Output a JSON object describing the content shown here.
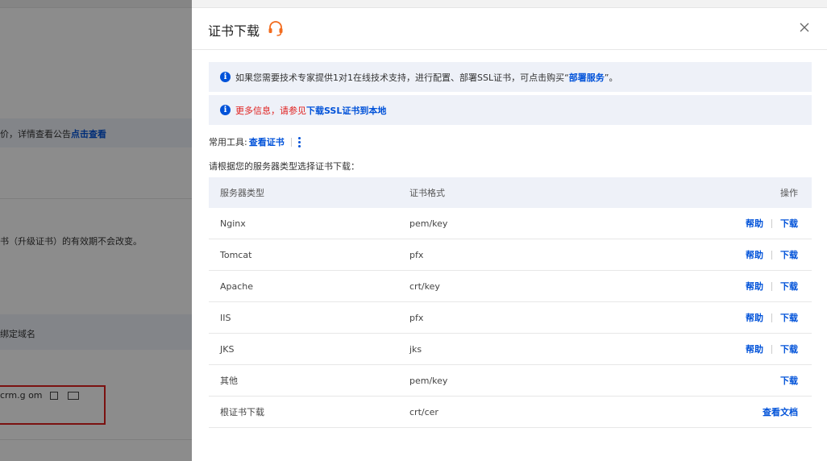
{
  "background": {
    "lines": [
      {
        "prefix": "价，详情查看公告",
        "link": "点击查看"
      },
      {
        "prefix": "书（升级证书）的有效期不会改变。",
        "link": ""
      },
      {
        "prefix": "绑定域名",
        "link": ""
      },
      {
        "prefix": "crm.g        om",
        "link": ""
      }
    ]
  },
  "drawer": {
    "title": "证书下载",
    "notices": [
      {
        "text": "如果您需要技术专家提供1对1在线技术支持，进行配置、部署SSL证书，可点击购买“",
        "link": "部署服务",
        "suffix": "”。"
      },
      {
        "text": "更多信息，请参见",
        "link": "下载SSL证书到本地",
        "suffix": ""
      }
    ],
    "tools": {
      "label": "常用工具:",
      "link": "查看证书"
    },
    "hint": "请根据您的服务器类型选择证书下载：",
    "table": {
      "headers": [
        "服务器类型",
        "证书格式",
        "操作"
      ],
      "rows": [
        {
          "server": "Nginx",
          "format": "pem/key",
          "actions": [
            "帮助",
            "下载"
          ]
        },
        {
          "server": "Tomcat",
          "format": "pfx",
          "actions": [
            "帮助",
            "下载"
          ]
        },
        {
          "server": "Apache",
          "format": "crt/key",
          "actions": [
            "帮助",
            "下载"
          ]
        },
        {
          "server": "IIS",
          "format": "pfx",
          "actions": [
            "帮助",
            "下载"
          ]
        },
        {
          "server": "JKS",
          "format": "jks",
          "actions": [
            "帮助",
            "下载"
          ]
        },
        {
          "server": "其他",
          "format": "pem/key",
          "actions": [
            "下载"
          ]
        },
        {
          "server": "根证书下载",
          "format": "crt/cer",
          "actions": [
            "查看文档"
          ]
        }
      ]
    }
  },
  "colors": {
    "link": "#0052d9",
    "red": "#e0201e",
    "headset": "#f26b1d"
  }
}
